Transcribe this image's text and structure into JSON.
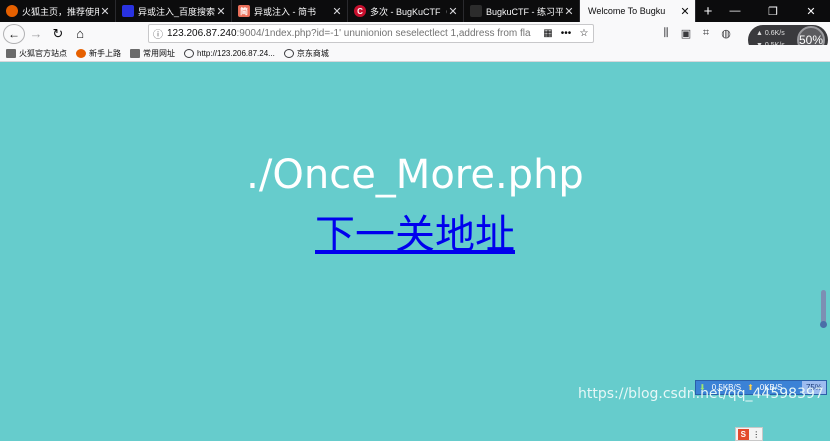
{
  "tabs": [
    {
      "title": "火狐主页，推荐使用 F",
      "favicon": "firefox-icon",
      "color": "#e66000",
      "glyph": "",
      "active": false
    },
    {
      "title": "异或注入_百度搜索",
      "favicon": "baidu-icon",
      "color": "#2932e1",
      "glyph": "",
      "active": false
    },
    {
      "title": "异或注入 - 简书",
      "favicon": "jianshu-icon",
      "color": "#ea6f5a",
      "glyph": "简",
      "active": false
    },
    {
      "title": "多次 - BugKuCTF（Sc",
      "favicon": "bugku-icon",
      "color": "#c8102e",
      "glyph": "C",
      "active": false
    },
    {
      "title": "BugkuCTF - 练习平台",
      "favicon": "bugku-dark-icon",
      "color": "#222222",
      "glyph": "",
      "active": false
    },
    {
      "title": "Welcome To Bugku",
      "favicon": "",
      "color": "",
      "glyph": "",
      "active": true
    }
  ],
  "url": {
    "host": "123.206.87.240",
    "path": ":9004/1ndex.php?id=-1' ununionion seselectlect 1,address from fla"
  },
  "bookmarks": [
    {
      "label": "火狐官方站点",
      "icon": "folder-icon"
    },
    {
      "label": "新手上路",
      "icon": "firefox-icon"
    },
    {
      "label": "常用网址",
      "icon": "folder-icon"
    },
    {
      "label": "http://123.206.87.24...",
      "icon": "globe-icon"
    },
    {
      "label": "京东商城",
      "icon": "globe-icon"
    }
  ],
  "netwidget": {
    "up": "0.6K/s",
    "down": "0.5K/s",
    "percent": "50%"
  },
  "page": {
    "heading": "./Once_More.php",
    "link_text": "下一关地址"
  },
  "speedbar": {
    "down": "0.5KB/S",
    "up": "0KB/S",
    "percent": "75%"
  },
  "watermark": "https://blog.csdn.net/qq_44598397"
}
